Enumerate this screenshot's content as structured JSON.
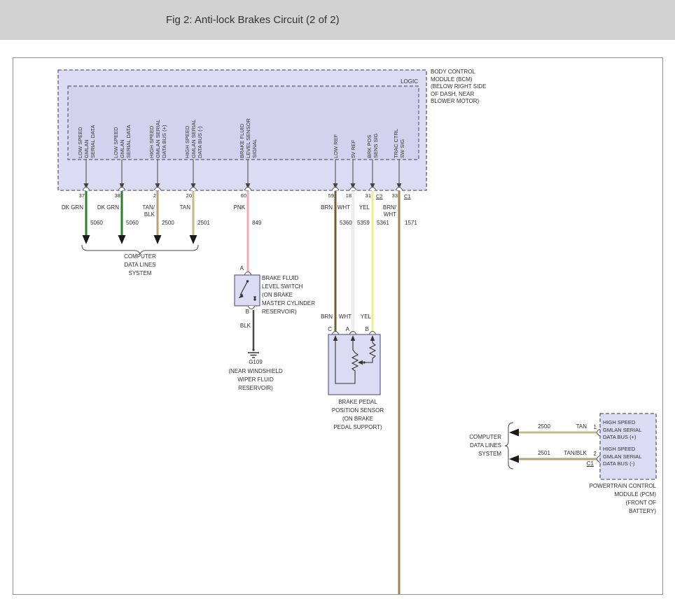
{
  "header": {
    "title": "Fig 2: Anti-lock Brakes Circuit (2 of 2)"
  },
  "colors": {
    "dk_grn": "#2c7d2c",
    "tan": "#c9b88a",
    "tan_blk": "#b5a276",
    "pnk": "#f2aab8",
    "brn": "#6e5f33",
    "wht_outline": "#cfcfcf",
    "wht_core": "#fbfbfb",
    "yel": "#efec90",
    "brn_wht": "#99874e",
    "blk": "#4a4a4a",
    "module_fill": "#dbdbf4",
    "logic_fill": "#d2d2ef"
  },
  "bcm": {
    "logic": "LOGIC",
    "name": "BODY CONTROL\nMODULE (BCM)\n(BELOW RIGHT SIDE\nOF DASH, NEAR\nBLOWER MOTOR)",
    "pins": {
      "p37": {
        "num": "37",
        "fn": "LOW SPEED\nGMLAN\nSERIAL DATA",
        "color": "DK GRN",
        "circuit": "5060"
      },
      "p38": {
        "num": "38",
        "fn": "LOW SPEED\nGMLAN\nSERIAL DATA",
        "color": "DK GRN",
        "circuit": "5060"
      },
      "p2": {
        "num": "2",
        "fn": "HIGH SPEED\nGMLAN SERIAL\nDATA BUS (+)",
        "color": "TAN/\nBLK",
        "circuit": "2500"
      },
      "p20": {
        "num": "20",
        "fn": "HIGH SPEED\nGMLAN SERIAL\nDATA BUS (-)",
        "color": "TAN",
        "circuit": "2501"
      },
      "p60": {
        "num": "60",
        "fn": "BRAKE FLUID\nLEVEL SENSOR\nSIGNAL",
        "color": "PNK",
        "circuit": "849"
      },
      "p59": {
        "num": "59",
        "fn": "LOW REF",
        "color": "BRN",
        "circuit": "5360"
      },
      "p18": {
        "num": "18",
        "fn": "5V REF",
        "color": "WHT",
        "circuit": "5359"
      },
      "p31": {
        "num": "31",
        "conn": "C2",
        "fn": "BRK POS\nSENS SIG",
        "color": "YEL",
        "circuit": "5361"
      },
      "p33": {
        "num": "33",
        "conn": "C1",
        "fn": "TRAC CTRL\nSW SIG",
        "color": "BRN/\nWHT",
        "circuit": "1571"
      }
    }
  },
  "computer_data_lines": {
    "label": "COMPUTER\nDATA LINES\nSYSTEM"
  },
  "fluid_switch": {
    "pin_a": "A",
    "pin_b": "B",
    "name": "BRAKE FLUID\nLEVEL SWITCH\n(ON BRAKE\nMASTER CYLINDER\nRESERVOIR)",
    "wire_color": "BLK"
  },
  "ground": {
    "id": "G109",
    "location": "(NEAR WINDSHIELD\nWIPER FLUID\nRESERVOIR)"
  },
  "pedal_sensor": {
    "wire1": "BRN",
    "wire2": "WHT",
    "wire3": "YEL",
    "pin_c": "C",
    "pin_a": "A",
    "pin_b": "B",
    "name": "BRAKE PEDAL\nPOSITION SENSOR\n(ON BRAKE\nPEDAL SUPPORT)"
  },
  "pcm": {
    "group_label": "COMPUTER\nDATA LINES\nSYSTEM",
    "wire1": {
      "circuit": "2500",
      "color": "TAN",
      "pin": "1",
      "fn": "HIGH SPEED\nGMLAN SERIAL\nDATA BUS (+)"
    },
    "wire2": {
      "circuit": "2501",
      "color": "TAN/BLK",
      "pin": "2",
      "conn": "C1",
      "fn": "HIGH SPEED\nGMLAN SERIAL\nDATA BUS (-)"
    },
    "name": "POWERTRAIN CONTROL\nMODULE (PCM)\n(FRONT OF\nBATTERY)"
  }
}
